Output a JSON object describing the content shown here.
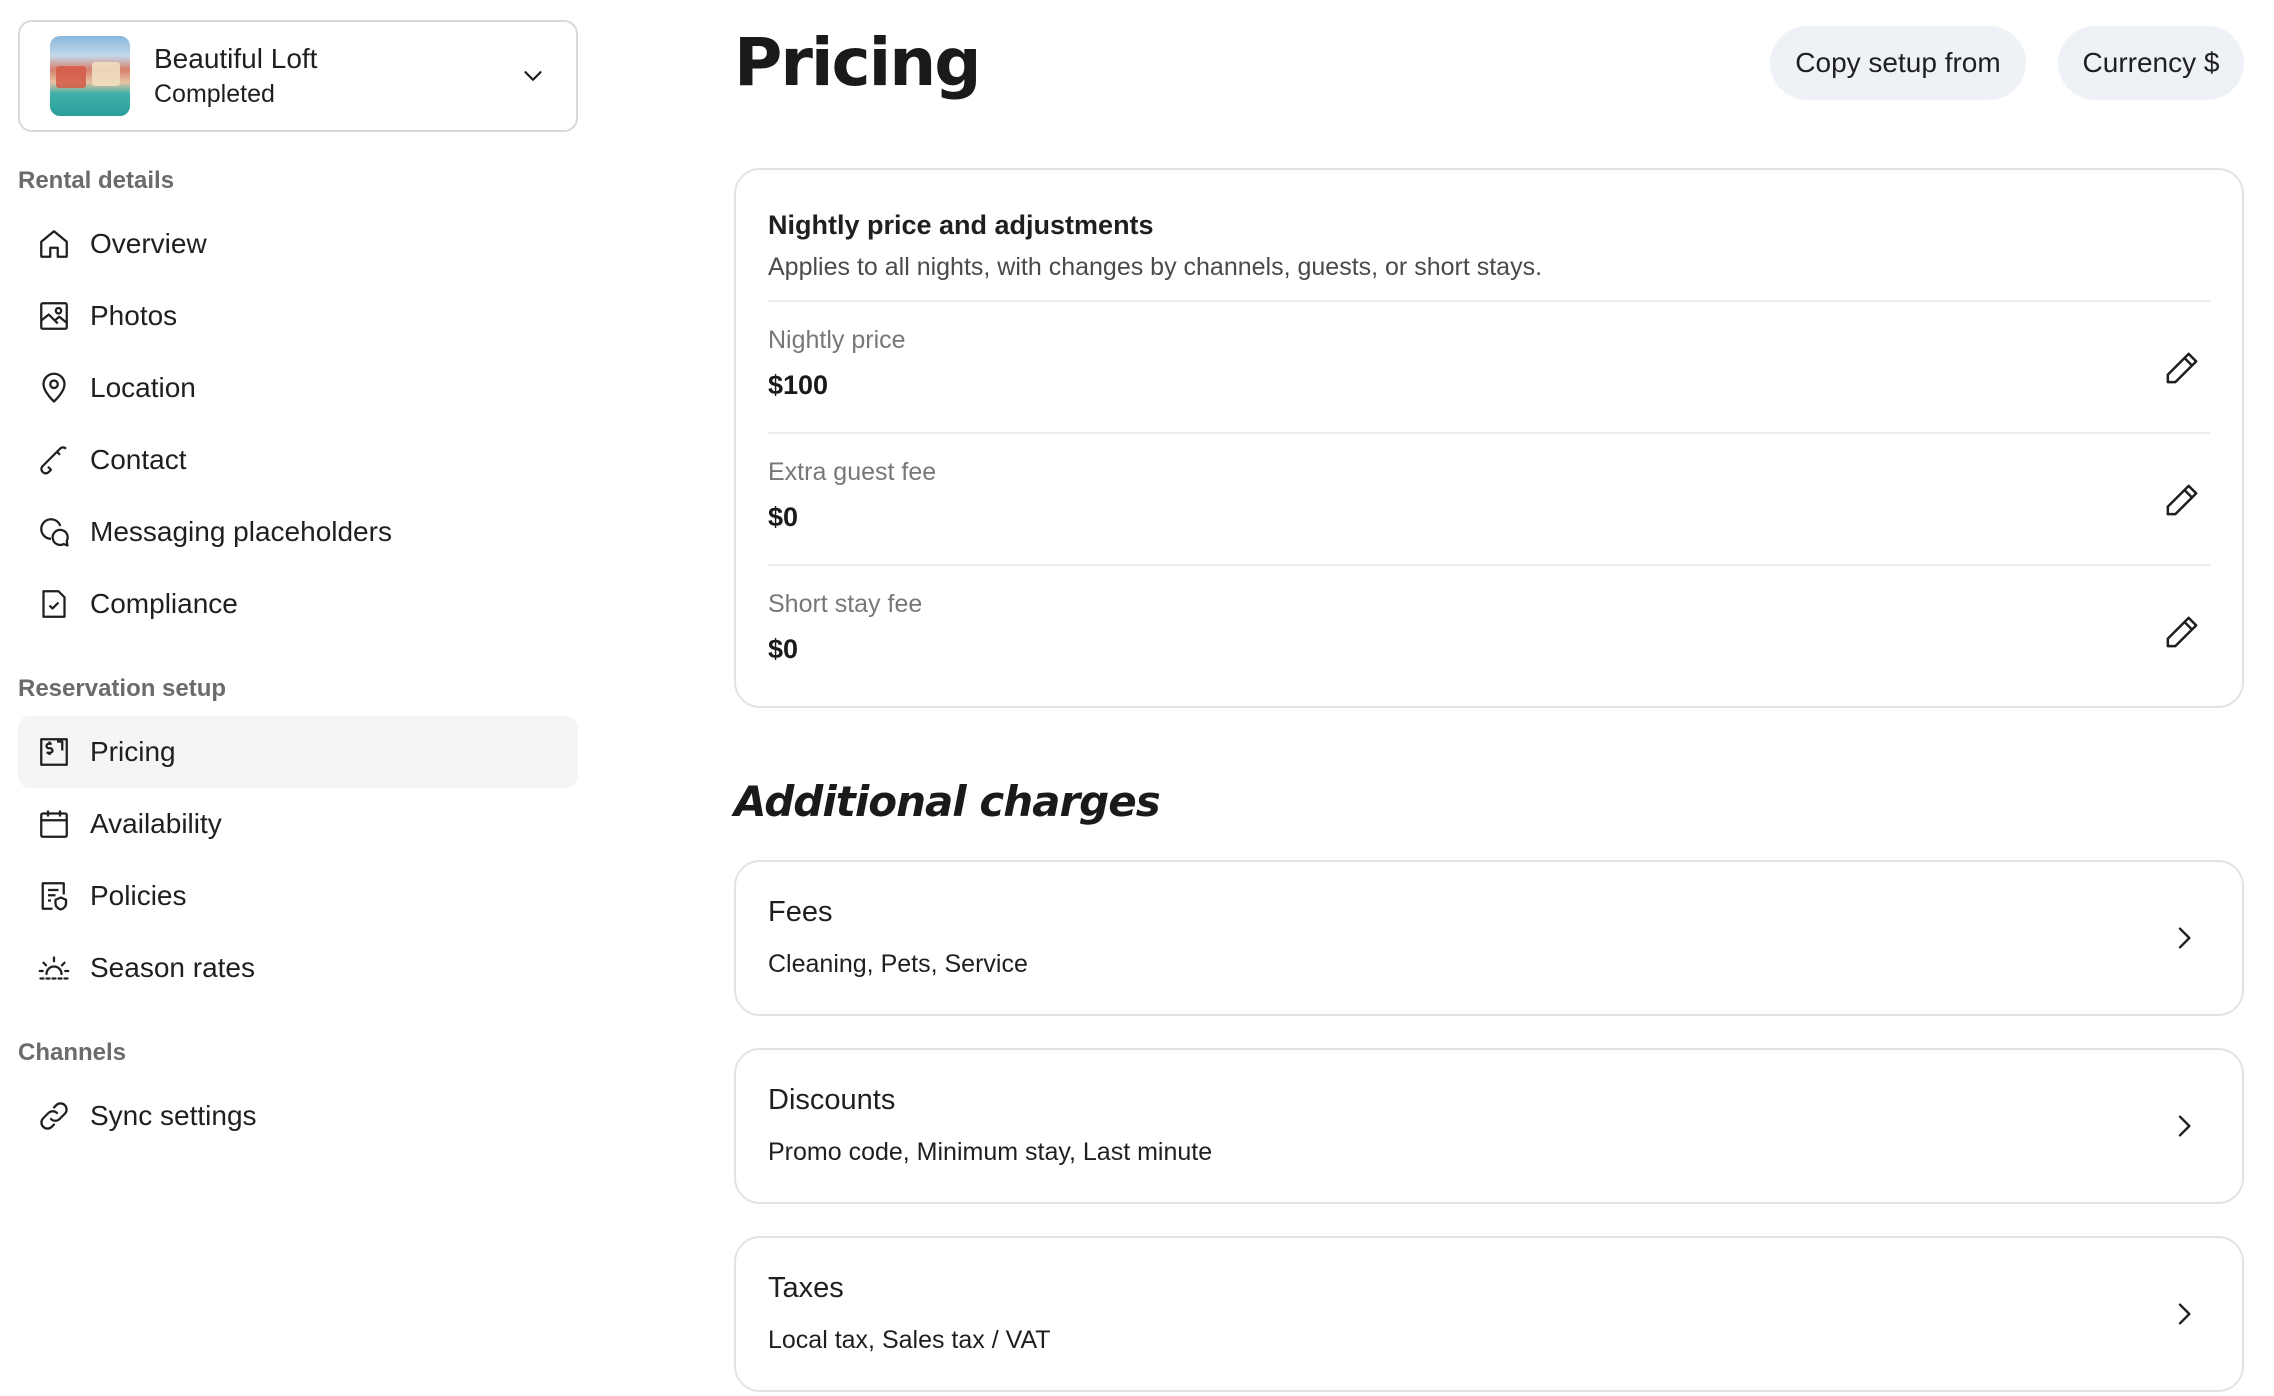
{
  "property": {
    "name": "Beautiful Loft",
    "status": "Completed"
  },
  "sidebar": {
    "sections": [
      {
        "heading": "Rental details",
        "items": [
          {
            "label": "Overview",
            "icon": "home-icon"
          },
          {
            "label": "Photos",
            "icon": "photo-icon"
          },
          {
            "label": "Location",
            "icon": "location-pin-icon"
          },
          {
            "label": "Contact",
            "icon": "phone-icon"
          },
          {
            "label": "Messaging placeholders",
            "icon": "chat-bubble-icon"
          },
          {
            "label": "Compliance",
            "icon": "document-check-icon"
          }
        ]
      },
      {
        "heading": "Reservation setup",
        "items": [
          {
            "label": "Pricing",
            "icon": "price-tag-icon",
            "active": true
          },
          {
            "label": "Availability",
            "icon": "calendar-icon"
          },
          {
            "label": "Policies",
            "icon": "policy-document-icon"
          },
          {
            "label": "Season rates",
            "icon": "sun-icon"
          }
        ]
      },
      {
        "heading": "Channels",
        "items": [
          {
            "label": "Sync settings",
            "icon": "link-icon"
          }
        ]
      }
    ]
  },
  "header": {
    "title": "Pricing",
    "copy_setup_label": "Copy setup from",
    "currency_label": "Currency $"
  },
  "nightly": {
    "title": "Nightly price and adjustments",
    "subtitle": "Applies to all nights, with changes by channels, guests, or short stays.",
    "rows": [
      {
        "label": "Nightly price",
        "value": "$100"
      },
      {
        "label": "Extra guest fee",
        "value": "$0"
      },
      {
        "label": "Short stay fee",
        "value": "$0"
      }
    ]
  },
  "additional": {
    "title": "Additional charges",
    "cards": [
      {
        "title": "Fees",
        "subtitle": "Cleaning, Pets, Service"
      },
      {
        "title": "Discounts",
        "subtitle": "Promo code, Minimum stay, Last minute"
      },
      {
        "title": "Taxes",
        "subtitle": "Local tax, Sales tax / VAT"
      }
    ]
  },
  "colors": {
    "active_nav_bg": "#f5f5f5",
    "header_button_bg": "#eef1f5",
    "card_border": "#e3e3e3",
    "muted_text": "#777777"
  }
}
